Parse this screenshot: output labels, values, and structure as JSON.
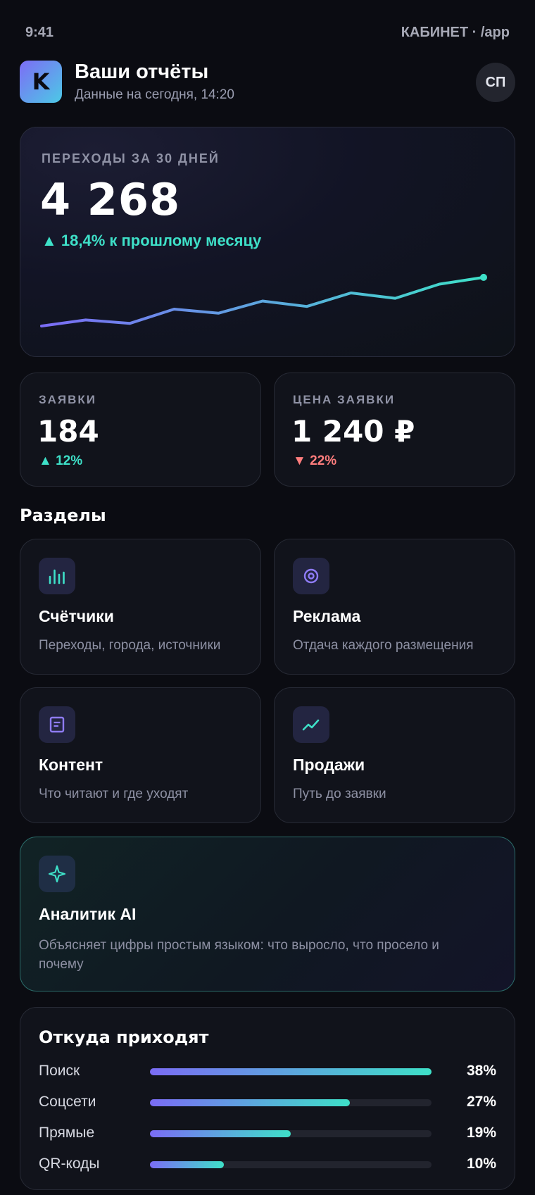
{
  "status_bar": {
    "time": "9:41",
    "context": "КАБИНЕТ · /app"
  },
  "header": {
    "logo_letter": "K",
    "title": "Ваши отчёты",
    "subtitle": "Данные на сегодня, 14:20",
    "avatar_initials": "СП"
  },
  "hero": {
    "label": "ПЕРЕХОДЫ ЗА 30 ДНЕЙ",
    "value": "4 268",
    "delta": "▲ 18,4% к прошлому месяцу",
    "trend": [
      0.0,
      0.09,
      0.04,
      0.25,
      0.19,
      0.37,
      0.29,
      0.49,
      0.41,
      0.62,
      0.72
    ]
  },
  "kpis": {
    "leads": {
      "label": "ЗАЯВКИ",
      "value": "184",
      "delta": "▲ 12%"
    },
    "lead_cost": {
      "label": "ЦЕНА ЗАЯВКИ",
      "value": "1 240 ₽",
      "delta": "▼ 22%"
    }
  },
  "sections": {
    "title": "Разделы",
    "counters": {
      "icon": "bar-chart-icon",
      "title": "Счётчики",
      "desc": "Переходы, города, источники"
    },
    "ads": {
      "icon": "target-icon",
      "title": "Реклама",
      "desc": "Отдача каждого размещения"
    },
    "content": {
      "icon": "document-icon",
      "title": "Контент",
      "desc": "Что читают и где уходят"
    },
    "sales": {
      "icon": "trend-up-icon",
      "title": "Продажи",
      "desc": "Путь до заявки"
    }
  },
  "ai": {
    "icon": "sparkle-icon",
    "title": "Аналитик AI",
    "desc": "Объясняет цифры простым языком: что выросло, что просело и почему"
  },
  "sources": {
    "title": "Откуда приходят",
    "items": [
      {
        "label": "Поиск",
        "value": "38%",
        "share": 0.38
      },
      {
        "label": "Соцсети",
        "value": "27%",
        "share": 0.27
      },
      {
        "label": "Прямые",
        "value": "19%",
        "share": 0.19
      },
      {
        "label": "QR-коды",
        "value": "10%",
        "share": 0.1
      }
    ]
  },
  "colors": {
    "accent_start": "#7b6cf5",
    "accent_end": "#3ee0c8",
    "positive": "#3ee0c8",
    "negative": "#ff7d7d",
    "background": "#0b0c12"
  }
}
